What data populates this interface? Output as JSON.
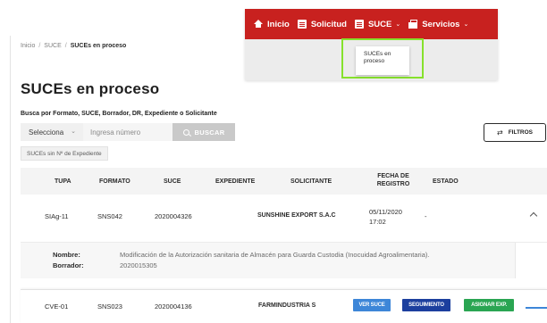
{
  "breadcrumb": {
    "items": [
      "Inicio",
      "SUCE"
    ],
    "current": "SUCEs en proceso",
    "separator": "/"
  },
  "nav": {
    "color": "#c8211f",
    "items": [
      {
        "label": "Inicio",
        "icon": "home-icon"
      },
      {
        "label": "Solicitud",
        "icon": "document-icon"
      },
      {
        "label": "SUCE",
        "icon": "document-icon",
        "caret": "⌄"
      },
      {
        "label": "Servicios",
        "icon": "box-icon",
        "caret": "⌄"
      }
    ],
    "dropdown": {
      "line1": "SUCEs en",
      "line2": "proceso"
    }
  },
  "page": {
    "title": "SUCEs en proceso",
    "search_label": "Busca por Formato, SUCE, Borrador, DR, Expediente o Solicitante"
  },
  "search": {
    "select_value": "Selecciona",
    "input_placeholder": "Ingresa número",
    "button_label": "BUSCAR",
    "filters_label": "FILTROS"
  },
  "chip": {
    "label": "SUCEs sin Nº de Expediente"
  },
  "table": {
    "headers": {
      "tupa": "TUPA",
      "formato": "FORMATO",
      "suce": "SUCE",
      "expediente": "EXPEDIENTE",
      "solicitante": "SOLICITANTE",
      "fecha_line1": "FECHA DE",
      "fecha_line2": "REGISTRO",
      "estado": "ESTADO"
    },
    "rows": [
      {
        "tupa": "SIAg-11",
        "formato": "SNS042",
        "suce": "2020004326",
        "expediente": "",
        "solicitante": "SUNSHINE EXPORT S.A.C",
        "fecha_line1": "05/11/2020",
        "fecha_line2": "17:02",
        "estado": "-"
      },
      {
        "tupa": "CVE-01",
        "formato": "SNS023",
        "suce": "2020004136",
        "expediente": "",
        "solicitante": "FARMINDUSTRIA S",
        "buttons": {
          "ver": "VER SUCE",
          "seguimiento": "SEGUIMIENTO",
          "asignar": "ASIGNAR EXP."
        }
      }
    ],
    "detail": {
      "nombre_label": "Nombre:",
      "nombre_value": "Modificación de la Autorización sanitaria de Almacén para Guarda Custodia (Inocuidad Agroalimentaria).",
      "borrador_label": "Borrador:",
      "borrador_value": "2020015305"
    }
  },
  "colors": {
    "accent_red": "#c8211f",
    "button_blue": "#3d86d8",
    "button_navy": "#1c3f9e",
    "button_green": "#2aa552",
    "highlight": "#86e12c"
  }
}
